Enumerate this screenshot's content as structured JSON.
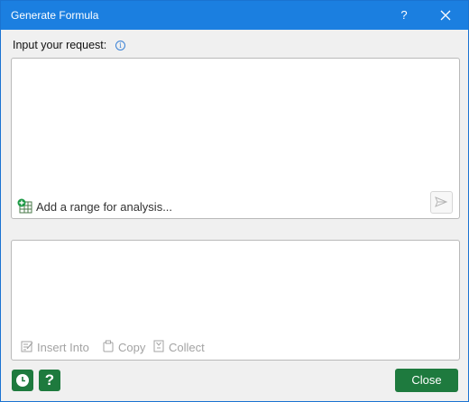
{
  "window": {
    "title": "Generate Formula",
    "help_glyph": "?"
  },
  "request": {
    "label": "Input your request:",
    "info_glyph": "i",
    "range_hint": "Add a range for analysis..."
  },
  "result": {
    "actions": [
      {
        "label": "Insert Into",
        "icon": "insert-icon"
      },
      {
        "label": "Copy",
        "icon": "copy-icon"
      },
      {
        "label": "Collect",
        "icon": "collect-icon"
      }
    ]
  },
  "footer": {
    "help_glyph": "?",
    "close_label": "Close"
  },
  "colors": {
    "titlebar": "#1b7fe0",
    "accent_green": "#1e7a3e",
    "disabled_text": "#a3a3a3"
  }
}
